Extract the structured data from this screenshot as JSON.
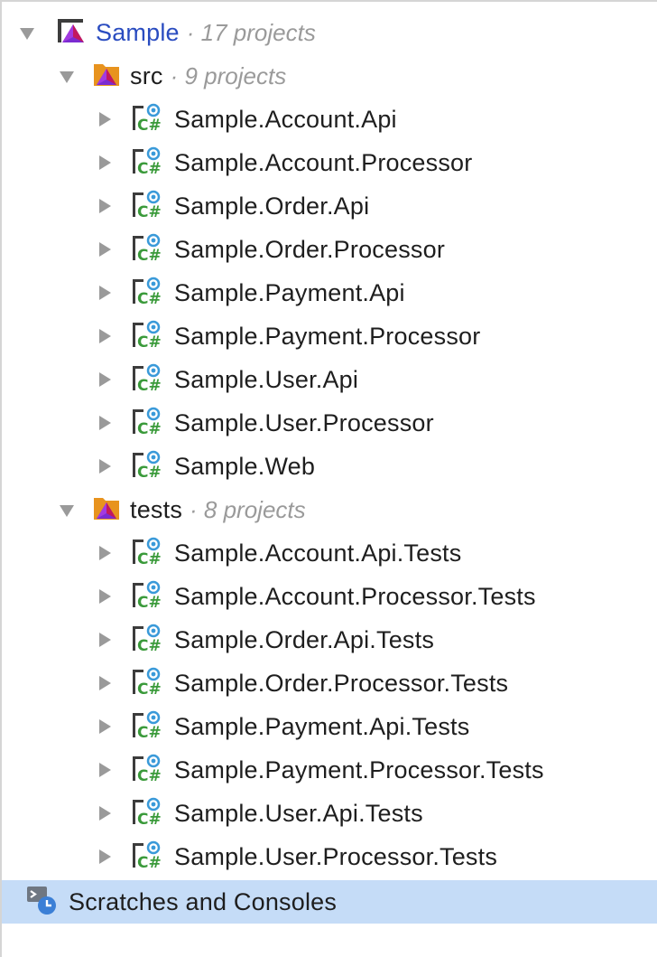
{
  "tree": {
    "solution": {
      "label": "Sample",
      "count": "· 17 projects"
    },
    "folders": [
      {
        "label": "src",
        "count": "· 9 projects",
        "projects": [
          "Sample.Account.Api",
          "Sample.Account.Processor",
          "Sample.Order.Api",
          "Sample.Order.Processor",
          "Sample.Payment.Api",
          "Sample.Payment.Processor",
          "Sample.User.Api",
          "Sample.User.Processor",
          "Sample.Web"
        ]
      },
      {
        "label": "tests",
        "count": "· 8 projects",
        "projects": [
          "Sample.Account.Api.Tests",
          "Sample.Account.Processor.Tests",
          "Sample.Order.Api.Tests",
          "Sample.Order.Processor.Tests",
          "Sample.Payment.Api.Tests",
          "Sample.Payment.Processor.Tests",
          "Sample.User.Api.Tests",
          "Sample.User.Processor.Tests"
        ]
      }
    ],
    "scratches": {
      "label": "Scratches and Consoles",
      "selected": true
    }
  },
  "icons": {
    "solution": "solution-icon",
    "folder": "solution-folder-icon",
    "project": "csharp-project-icon",
    "scratches": "scratches-icon"
  },
  "colors": {
    "selection": "#c5dcf7",
    "solution_text": "#2a4cc0",
    "secondary_text": "#9a9a9a",
    "csharp_green": "#3a9a3a",
    "folder_orange": "#e8931e",
    "rider_purple": "#7b2bd1"
  }
}
